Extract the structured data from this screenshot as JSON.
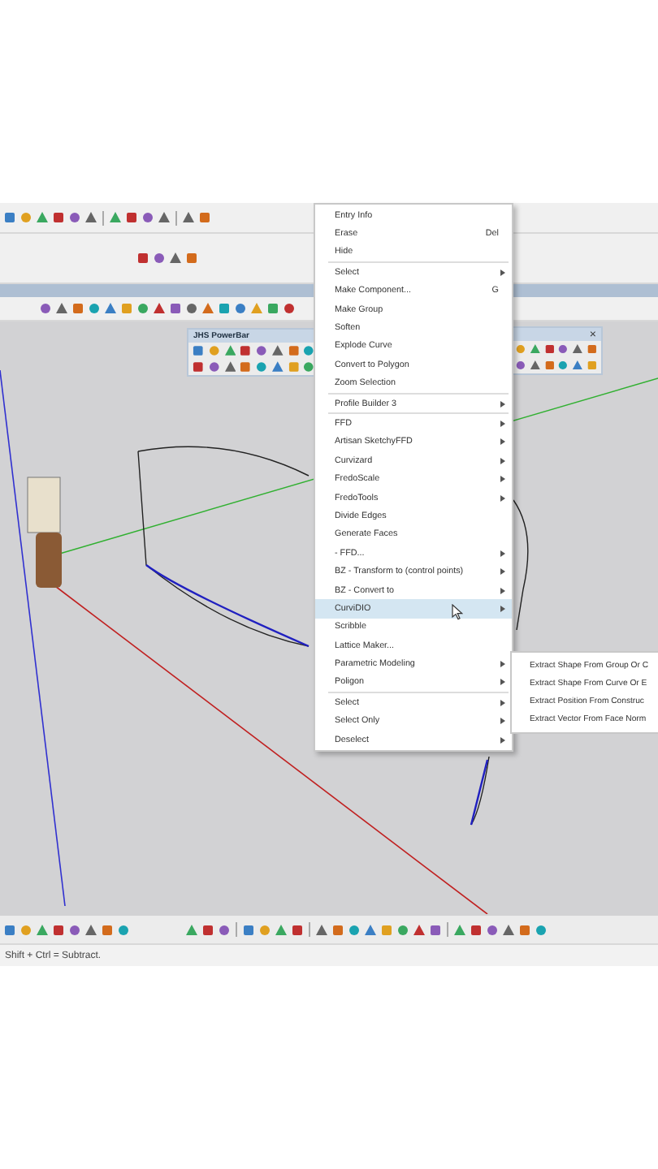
{
  "context_menu": {
    "items": [
      {
        "kind": "item",
        "label": "Entry Info",
        "selected": false
      },
      {
        "kind": "item",
        "label": "Erase",
        "shortcut": "Del",
        "selected": false
      },
      {
        "kind": "item",
        "label": "Hide",
        "selected": false
      },
      {
        "kind": "separator"
      },
      {
        "kind": "item",
        "label": "Select",
        "has_submenu": true,
        "selected": false
      },
      {
        "kind": "item",
        "label": "Make Component...",
        "shortcut": "G",
        "selected": false
      },
      {
        "kind": "item",
        "label": "Make Group",
        "selected": false
      },
      {
        "kind": "item",
        "label": "Soften",
        "selected": false
      },
      {
        "kind": "item",
        "label": "Explode Curve",
        "selected": false
      },
      {
        "kind": "item",
        "label": "Convert to Polygon",
        "selected": false
      },
      {
        "kind": "item",
        "label": "Zoom Selection",
        "selected": false
      },
      {
        "kind": "separator"
      },
      {
        "kind": "item",
        "label": "Profile Builder 3",
        "has_submenu": true,
        "selected": false
      },
      {
        "kind": "separator"
      },
      {
        "kind": "item",
        "label": "FFD",
        "has_submenu": true,
        "selected": false
      },
      {
        "kind": "item",
        "label": "Artisan SketchyFFD",
        "has_submenu": true,
        "selected": false
      },
      {
        "kind": "item",
        "label": "Curvizard",
        "has_submenu": true,
        "selected": false
      },
      {
        "kind": "item",
        "label": "FredoScale",
        "has_submenu": true,
        "selected": false
      },
      {
        "kind": "item",
        "label": "FredoTools",
        "has_submenu": true,
        "selected": false
      },
      {
        "kind": "item",
        "label": "Divide Edges",
        "selected": false
      },
      {
        "kind": "item",
        "label": "Generate Faces",
        "selected": false
      },
      {
        "kind": "item",
        "label": "- FFD...",
        "has_submenu": true,
        "selected": false
      },
      {
        "kind": "item",
        "label": "BZ - Transform to (control points)",
        "has_submenu": true,
        "selected": false
      },
      {
        "kind": "item",
        "label": "BZ - Convert to",
        "has_submenu": true,
        "selected": false
      },
      {
        "kind": "item",
        "label": "CurviDIO",
        "has_submenu": true,
        "selected": true
      },
      {
        "kind": "item",
        "label": "Scribble",
        "selected": false
      },
      {
        "kind": "item",
        "label": "Lattice Maker...",
        "selected": false
      },
      {
        "kind": "item",
        "label": "Parametric Modeling",
        "has_submenu": true,
        "selected": false
      },
      {
        "kind": "item",
        "label": "Poligon",
        "has_submenu": true,
        "selected": false
      },
      {
        "kind": "separator"
      },
      {
        "kind": "item",
        "label": "Select",
        "has_submenu": true,
        "selected": false
      },
      {
        "kind": "item",
        "label": "Select Only",
        "has_submenu": true,
        "selected": false
      },
      {
        "kind": "item",
        "label": "Deselect",
        "has_submenu": true,
        "selected": false
      }
    ]
  },
  "submenu": {
    "items": [
      {
        "label": "Extract Shape From Group Or C"
      },
      {
        "label": "Extract Shape From Curve Or E"
      },
      {
        "label": "Extract Position From Construc"
      },
      {
        "label": "Extract Vector From Face Norm"
      }
    ]
  },
  "floating_toolbar": {
    "title": "JHS PowerBar",
    "close": "×"
  },
  "status_bar": {
    "text": "Shift + Ctrl = Subtract."
  }
}
